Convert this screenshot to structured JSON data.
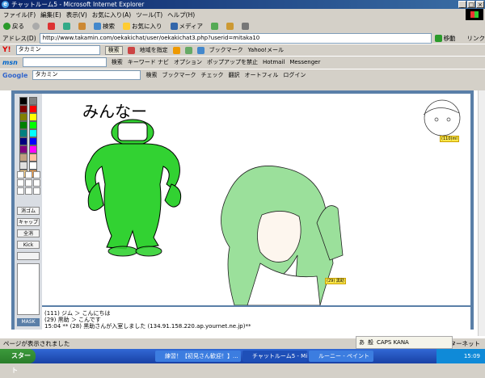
{
  "window": {
    "title": "チャットルーム5 - Microsoft Internet Explorer",
    "buttons": [
      "_",
      "□",
      "×"
    ]
  },
  "menu": [
    "ファイル(F)",
    "編集(E)",
    "表示(V)",
    "お気に入り(A)",
    "ツール(T)",
    "ヘルプ(H)"
  ],
  "toolbar": {
    "back": "戻る",
    "search": "検索",
    "favorites": "お気に入り",
    "media": "メディア"
  },
  "address": {
    "label": "アドレス(D)",
    "url": "http://www.takamin.com/oekakichat/user/oekakichat3.php?userid=mitaka10",
    "go": "移動",
    "links": "リンク"
  },
  "yahoo_bar": {
    "query": "タカミン",
    "search": "検索",
    "map": "地域を指定",
    "bookmark": "ブックマーク",
    "mail": "Yahoo!メール"
  },
  "msn_bar": {
    "logo": "msn",
    "search": "検索",
    "keyword": "キーワード ナビ",
    "options": "オプション",
    "popup": "ポップアップを禁止",
    "hotmail": "Hotmail",
    "messenger": "Messenger"
  },
  "google_bar": {
    "logo": "Google",
    "query": "タカミン",
    "search": "検索",
    "bookmark": "ブックマーク",
    "check": "チェック",
    "translate": "翻訳",
    "autofill": "オートフィル",
    "login": "ログイン"
  },
  "palette": {
    "colors": [
      "#000000",
      "#808080",
      "#800000",
      "#ff0000",
      "#808000",
      "#ffff00",
      "#008000",
      "#00ff00",
      "#008080",
      "#00ffff",
      "#000080",
      "#0000ff",
      "#800080",
      "#ff00ff",
      "#c0a080",
      "#ffc0a0",
      "#e0e0e0",
      "#ffffff",
      "#ffd080",
      "#ffa040"
    ],
    "tools": [
      "消ゴム",
      "キャップ",
      "全消",
      "Kick",
      "",
      "MASK"
    ]
  },
  "drawing": {
    "text": "みんなー",
    "mini_tag": "(110)ml",
    "name_tag": "(29) 黒助"
  },
  "chat": [
    "(111) ジム ＞ こんにちは",
    "(29) 黒助 ＞ こんです",
    "15:04 ** (28) 黒助さんが入室しました (134.91.158.220.ap.yournet.ne.jp)**"
  ],
  "status": {
    "text": "ページが表示されました",
    "zone": "インターネット"
  },
  "langbar": {
    "mode": "あ",
    "lang": "般",
    "caps": "CAPS KANA"
  },
  "taskbar": {
    "start": "スタート",
    "tasks": [
      "練習！【初見さん歓迎！】...",
      "チャットルーム5 - Micr...",
      "ルーニー - ペイント"
    ],
    "clock": "15:09"
  },
  "colors": {
    "titlebar": "#0a246a",
    "frame": "#5a7fa8",
    "green": "#32d232",
    "hair": "#9be09b"
  }
}
